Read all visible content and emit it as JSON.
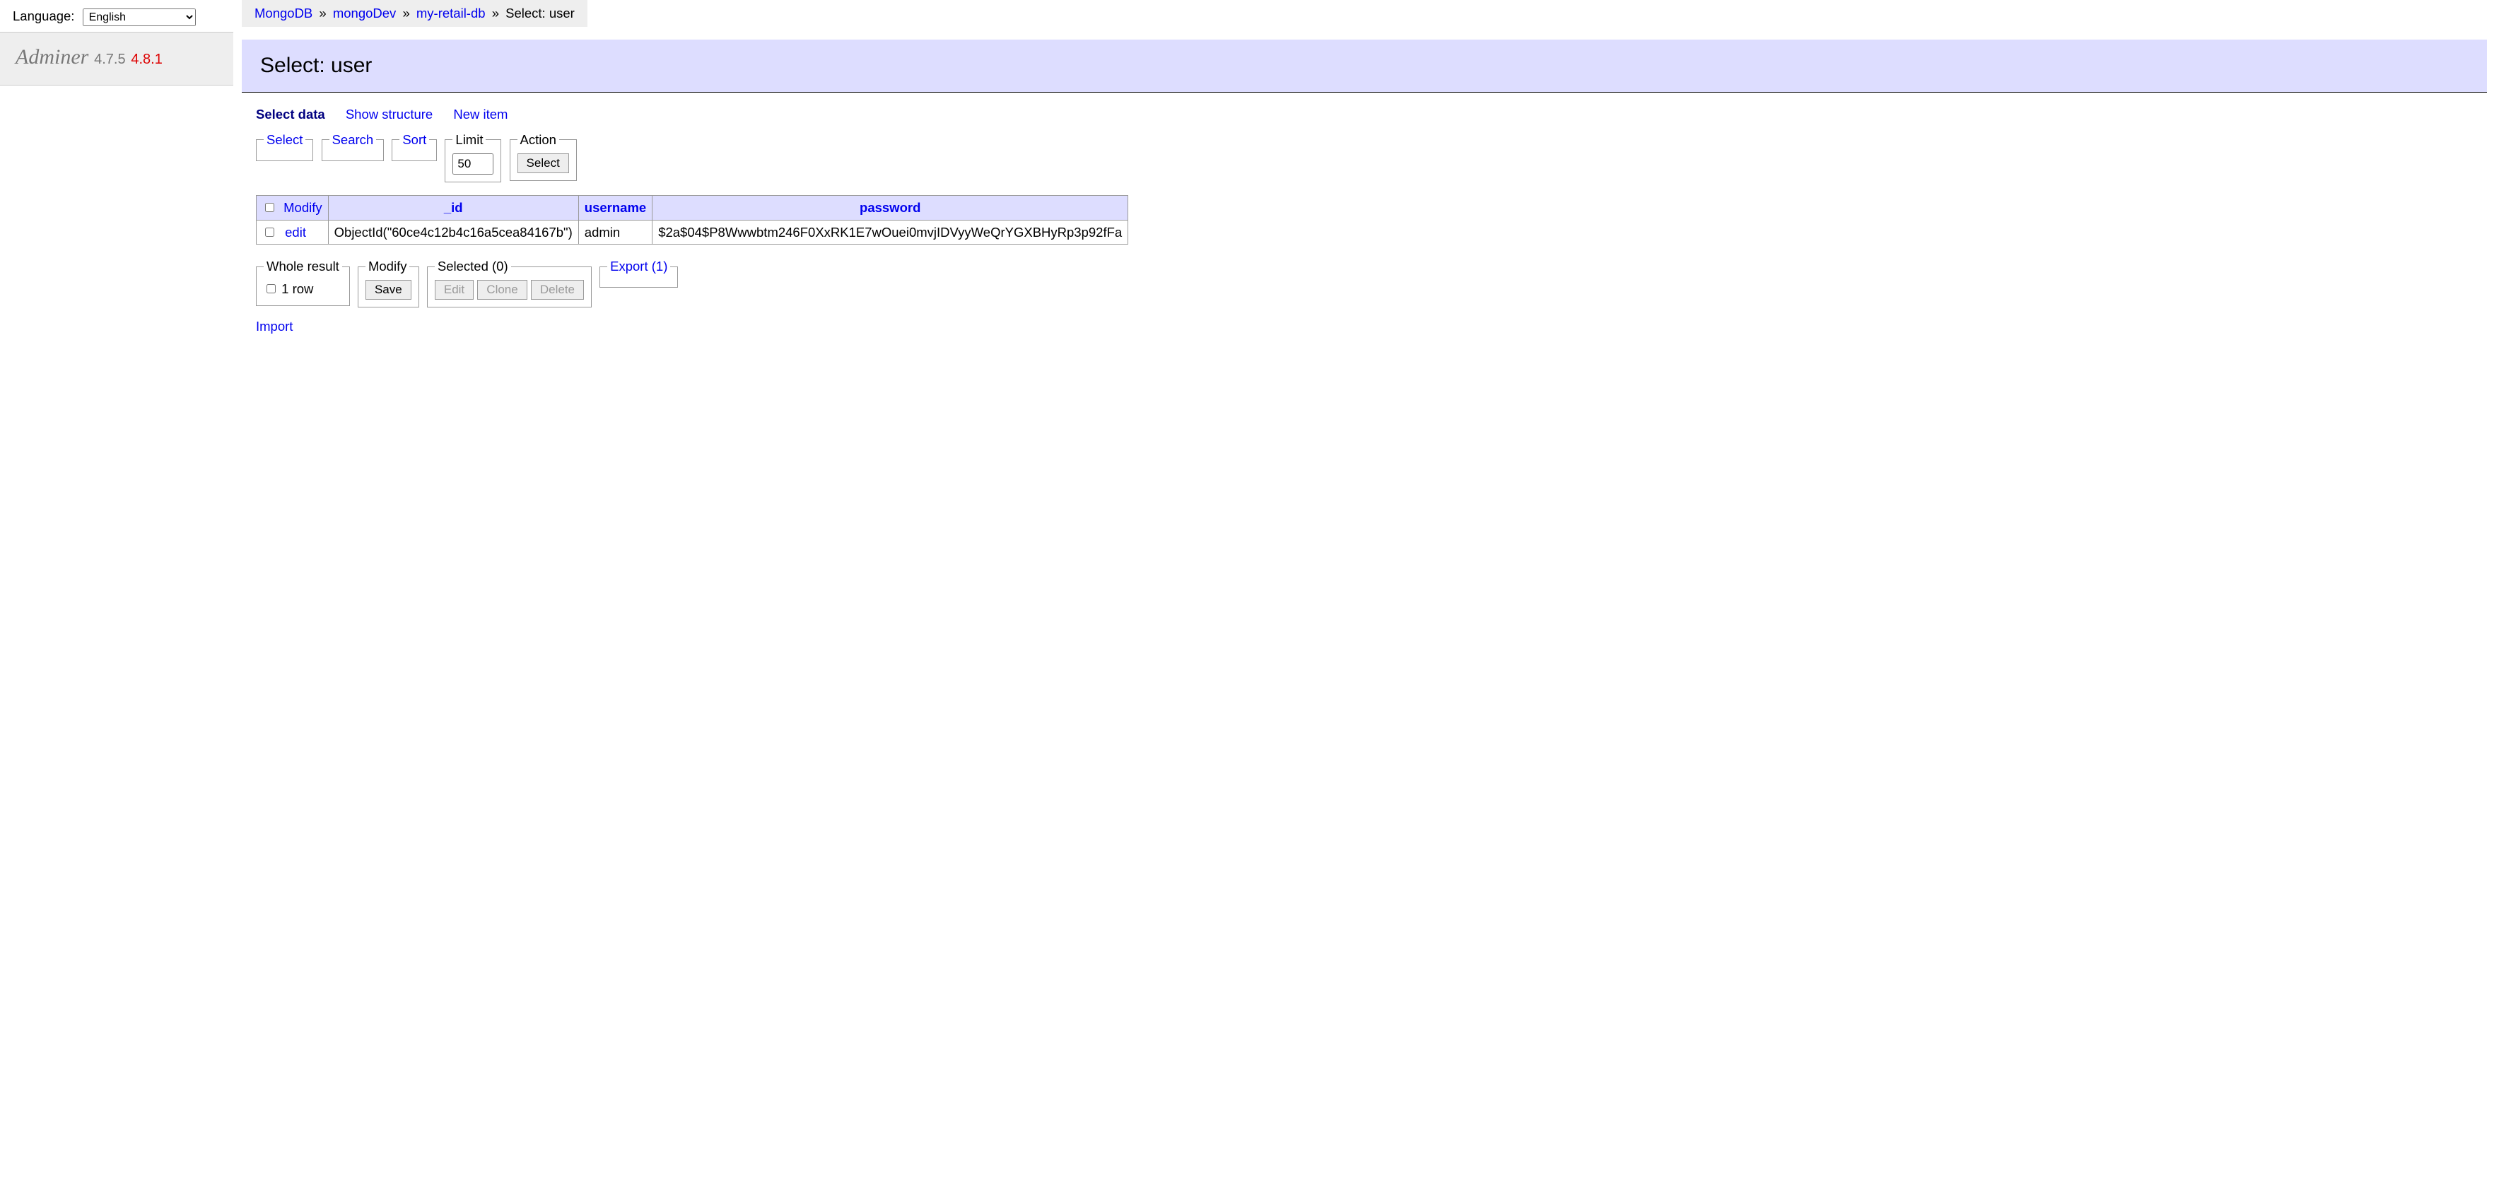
{
  "lang": {
    "label": "Language:",
    "options": [
      "English"
    ],
    "selected": "English"
  },
  "logo": {
    "name": "Adminer",
    "version": "4.7.5",
    "latest": "4.8.1"
  },
  "breadcrumb": {
    "db_engine": "MongoDB",
    "server": "mongoDev",
    "database": "my-retail-db",
    "current": "Select: user",
    "sep": "»"
  },
  "page_title": "Select: user",
  "tabs": {
    "select_data": "Select data",
    "show_structure": "Show structure",
    "new_item": "New item"
  },
  "filters": {
    "select": "Select",
    "search": "Search",
    "sort": "Sort",
    "limit_label": "Limit",
    "limit_value": "50",
    "action_label": "Action",
    "action_button": "Select"
  },
  "table": {
    "header_modify": "Modify",
    "col_id": "_id",
    "col_username": "username",
    "col_password": "password",
    "rows": [
      {
        "edit": "edit",
        "_id": "ObjectId(\"60ce4c12b4c16a5cea84167b\")",
        "username": "admin",
        "password": "$2a$04$P8Wwwbtm246F0XxRK1E7wOuei0mvjIDVyyWeQrYGXBHyRp3p92fFa"
      }
    ]
  },
  "footer": {
    "whole_result": "Whole result",
    "row_count": "1 row",
    "modify": "Modify",
    "save": "Save",
    "selected": "Selected (0)",
    "edit": "Edit",
    "clone": "Clone",
    "delete": "Delete",
    "export": "Export (1)"
  },
  "import": "Import"
}
